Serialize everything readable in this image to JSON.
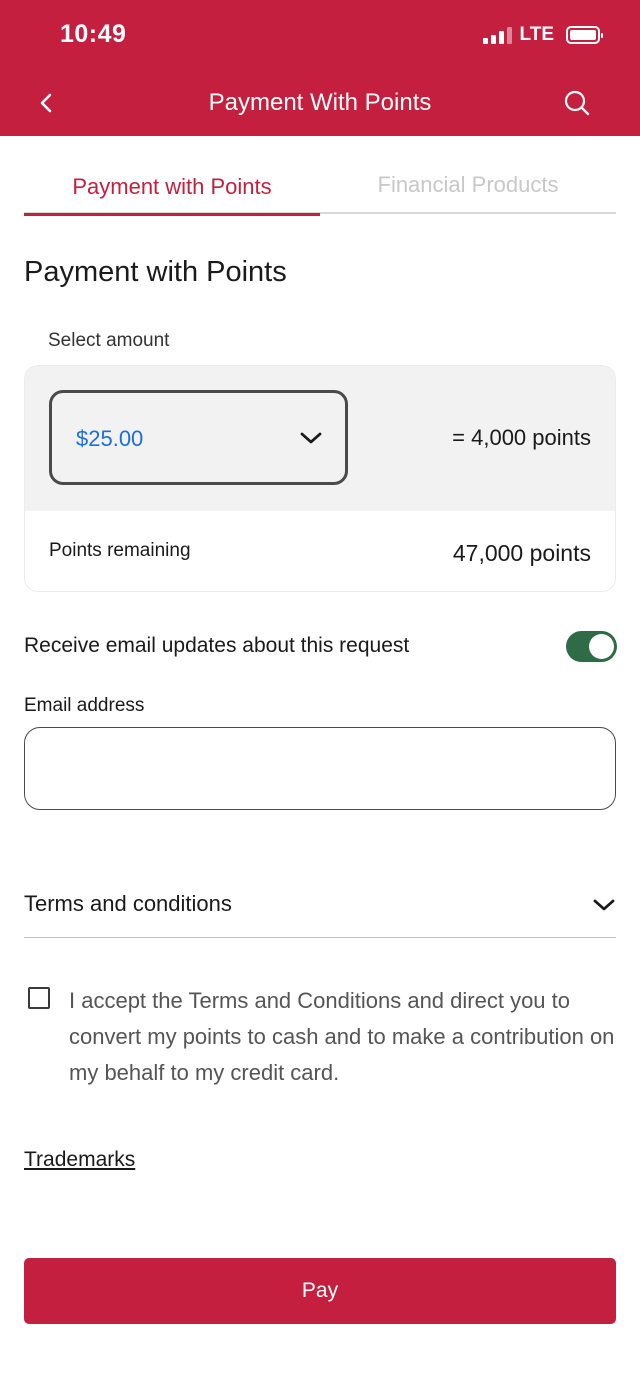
{
  "status_bar": {
    "time": "10:49",
    "network": "LTE"
  },
  "header": {
    "title": "Payment With Points",
    "back_icon": "chevron-left-icon",
    "search_icon": "search-icon",
    "background_color": "#c41f3e"
  },
  "tabs": [
    {
      "label": "Payment with Points",
      "active": true
    },
    {
      "label": "Financial Products",
      "active": false
    }
  ],
  "main": {
    "title": "Payment with Points",
    "select_label": "Select amount",
    "amount": {
      "selected_value": "$25.00",
      "equals_points": "=  4,000 points"
    },
    "remaining": {
      "label": "Points remaining",
      "value": "47,000 points"
    },
    "email_toggle": {
      "label": "Receive email updates about this request",
      "on": true,
      "color": "#2e6b46"
    },
    "email": {
      "label": "Email address",
      "value": "",
      "placeholder": ""
    },
    "terms": {
      "label": "Terms and conditions"
    },
    "accept": {
      "text": "I accept the Terms and Conditions and direct you to convert my points to cash and to make a contribution on my behalf to my credit card.",
      "checked": false
    },
    "trademarks_link": "Trademarks",
    "pay_button": "Pay"
  },
  "colors": {
    "accent": "#c41f3e",
    "link_blue": "#1a6fe0"
  }
}
